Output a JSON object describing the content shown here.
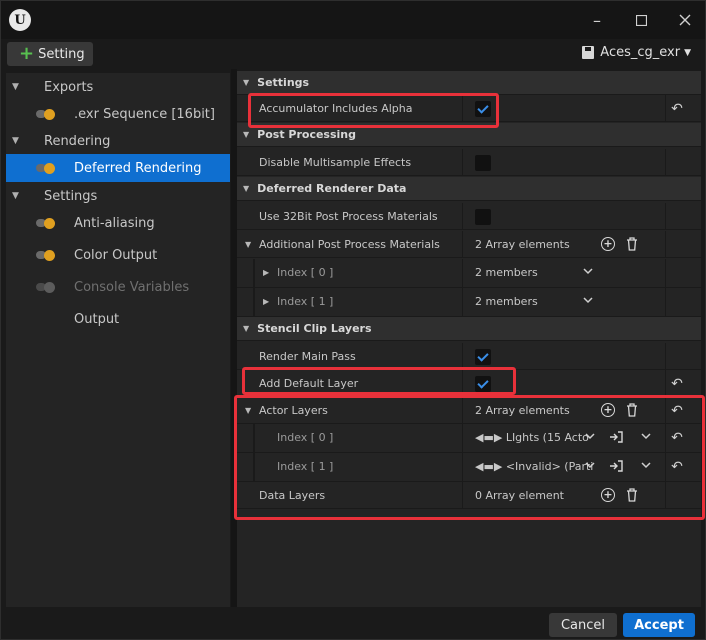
{
  "toolbar": {
    "add_setting_label": "Setting",
    "preset_name": "Aces_cg_exr"
  },
  "left_tree": {
    "exports_label": "Exports",
    "exr_sequence_label": ".exr Sequence [16bit]",
    "rendering_label": "Rendering",
    "deferred_rendering_label": "Deferred Rendering",
    "settings_label": "Settings",
    "anti_aliasing_label": "Anti-aliasing",
    "color_output_label": "Color Output",
    "console_variables_label": "Console Variables",
    "output_label": "Output"
  },
  "details": {
    "settings_cat": "Settings",
    "accumulator_alpha": "Accumulator Includes Alpha",
    "post_processing_cat": "Post Processing",
    "disable_msaa": "Disable Multisample Effects",
    "deferred_data_cat": "Deferred Renderer Data",
    "use_32bit": "Use 32Bit Post Process Materials",
    "additional_ppm": "Additional Post Process Materials",
    "additional_ppm_value": "2 Array elements",
    "index0_label": "Index [ 0 ]",
    "index0_value": "2 members",
    "index1_label": "Index [ 1 ]",
    "index1_value": "2 members",
    "stencil_cat": "Stencil Clip Layers",
    "render_main_pass": "Render Main Pass",
    "add_default_layer": "Add Default Layer",
    "actor_layers": "Actor Layers",
    "actor_layers_value": "2 Array elements",
    "actor_index0_label": "Index [ 0 ]",
    "actor_index0_value": "LIghts (15 Acto",
    "actor_index1_label": "Index [ 1 ]",
    "actor_index1_value": "<Invalid> (Parti",
    "data_layers": "Data Layers",
    "data_layers_value": "0 Array element"
  },
  "footer": {
    "cancel_label": "Cancel",
    "accept_label": "Accept"
  },
  "colors": {
    "accent": "#0f6fd0",
    "highlight": "#e8313a",
    "toggle_on": "#e0a020"
  },
  "checkboxes": {
    "accumulator_alpha": true,
    "disable_msaa": false,
    "use_32bit": false,
    "render_main_pass": true,
    "add_default_layer": true
  }
}
